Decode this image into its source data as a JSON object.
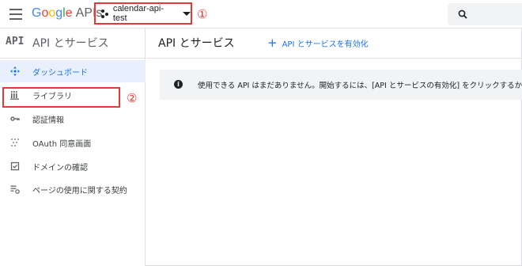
{
  "topbar": {
    "logo_letters": [
      "G",
      "o",
      "o",
      "g",
      "l",
      "e"
    ],
    "logo_suffix": "APIs",
    "project_name": "calendar-api-test",
    "annotation_1": "①",
    "search_icon": "search-icon"
  },
  "sidebar": {
    "api_mark": "API",
    "title": "API とサービス",
    "items": [
      {
        "label": "ダッシュボード",
        "icon": "dashboard-icon",
        "active": true
      },
      {
        "label": "ライブラリ",
        "icon": "library-icon",
        "active": false
      },
      {
        "label": "認証情報",
        "icon": "key-icon",
        "active": false
      },
      {
        "label": "OAuth 同意画面",
        "icon": "oauth-consent-icon",
        "active": false
      },
      {
        "label": "ドメインの確認",
        "icon": "domain-check-icon",
        "active": false
      },
      {
        "label": "ページの使用に関する契約",
        "icon": "agreement-icon",
        "active": false
      }
    ],
    "annotation_2": "②"
  },
  "main": {
    "title": "API とサービス",
    "enable_label": "API とサービスを有効化",
    "notice": "使用できる API はまだありません。開始するには、[API とサービスの有効化] をクリックするか、"
  },
  "colors": {
    "accent": "#1a73e8",
    "highlight_box": "#e53935",
    "active_bg": "#e8f0fe"
  }
}
